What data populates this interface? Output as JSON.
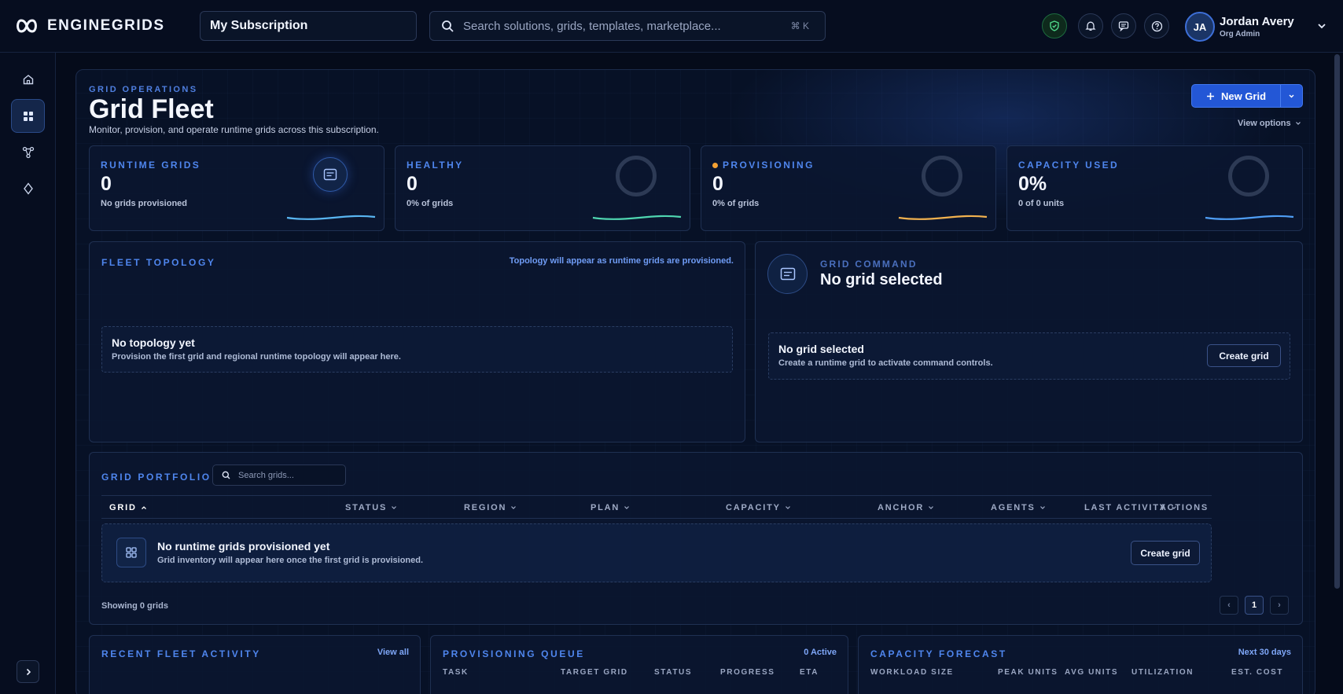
{
  "brand": {
    "name": "ENGINEGRIDS"
  },
  "header": {
    "subscription": "My Subscription",
    "search_placeholder": "Search solutions, grids, templates, marketplace...",
    "search_shortcut": "⌘ K",
    "user": {
      "initials": "JA",
      "name": "Jordan Avery",
      "role": "Org Admin"
    }
  },
  "sidebar": {
    "items": [
      {
        "name": "home",
        "icon": "home-icon",
        "active": false
      },
      {
        "name": "grids",
        "icon": "grid-icon",
        "active": true
      },
      {
        "name": "topology",
        "icon": "nodes-icon",
        "active": false
      },
      {
        "name": "marketplace",
        "icon": "diamond-icon",
        "active": false
      }
    ]
  },
  "page": {
    "eyebrow": "GRID OPERATIONS",
    "title": "Grid Fleet",
    "subtitle": "Monitor, provision, and operate runtime grids across this subscription.",
    "new_grid_label": "New Grid",
    "view_options_label": "View options"
  },
  "stats": [
    {
      "label": "RUNTIME GRIDS",
      "value": "0",
      "sub": "No grids provisioned",
      "spark_color": "#59b6f2"
    },
    {
      "label": "HEALTHY",
      "value": "0",
      "sub": "0% of grids",
      "spark_color": "#4fd6b0"
    },
    {
      "label": "PROVISIONING",
      "value": "0",
      "sub": "0% of grids",
      "spark_color": "#f2b24f"
    },
    {
      "label": "CAPACITY USED",
      "value": "0%",
      "sub": "0 of 0 units",
      "spark_color": "#4f9ef5"
    }
  ],
  "topology": {
    "label": "FLEET TOPOLOGY",
    "note": "Topology will appear as runtime grids are provisioned.",
    "empty_title": "No topology yet",
    "empty_sub": "Provision the first grid and regional runtime topology will appear here."
  },
  "command": {
    "eyebrow": "GRID COMMAND",
    "title": "No grid selected",
    "empty_title": "No grid selected",
    "empty_sub": "Create a runtime grid to activate command controls.",
    "button": "Create grid"
  },
  "portfolio": {
    "label": "GRID PORTFOLIO",
    "search_placeholder": "Search grids...",
    "columns": [
      "GRID",
      "STATUS",
      "REGION",
      "PLAN",
      "CAPACITY",
      "ANCHOR",
      "AGENTS",
      "LAST ACTIVITY",
      "ACTIONS"
    ],
    "empty_title": "No runtime grids provisioned yet",
    "empty_sub": "Grid inventory will appear here once the first grid is provisioned.",
    "button": "Create grid",
    "showing": "Showing 0 grids",
    "pager": {
      "prev": "‹",
      "current": "1",
      "next": "›"
    }
  },
  "activity": {
    "label": "RECENT FLEET ACTIVITY",
    "link": "View all"
  },
  "queue": {
    "label": "PROVISIONING QUEUE",
    "count": "0 Active",
    "columns": [
      "TASK",
      "TARGET GRID",
      "STATUS",
      "PROGRESS",
      "ETA"
    ]
  },
  "forecast": {
    "label": "CAPACITY FORECAST",
    "range": "Next 30 days",
    "columns": [
      "WORKLOAD SIZE",
      "PEAK UNITS",
      "AVG UNITS",
      "UTILIZATION",
      "EST. COST"
    ]
  }
}
